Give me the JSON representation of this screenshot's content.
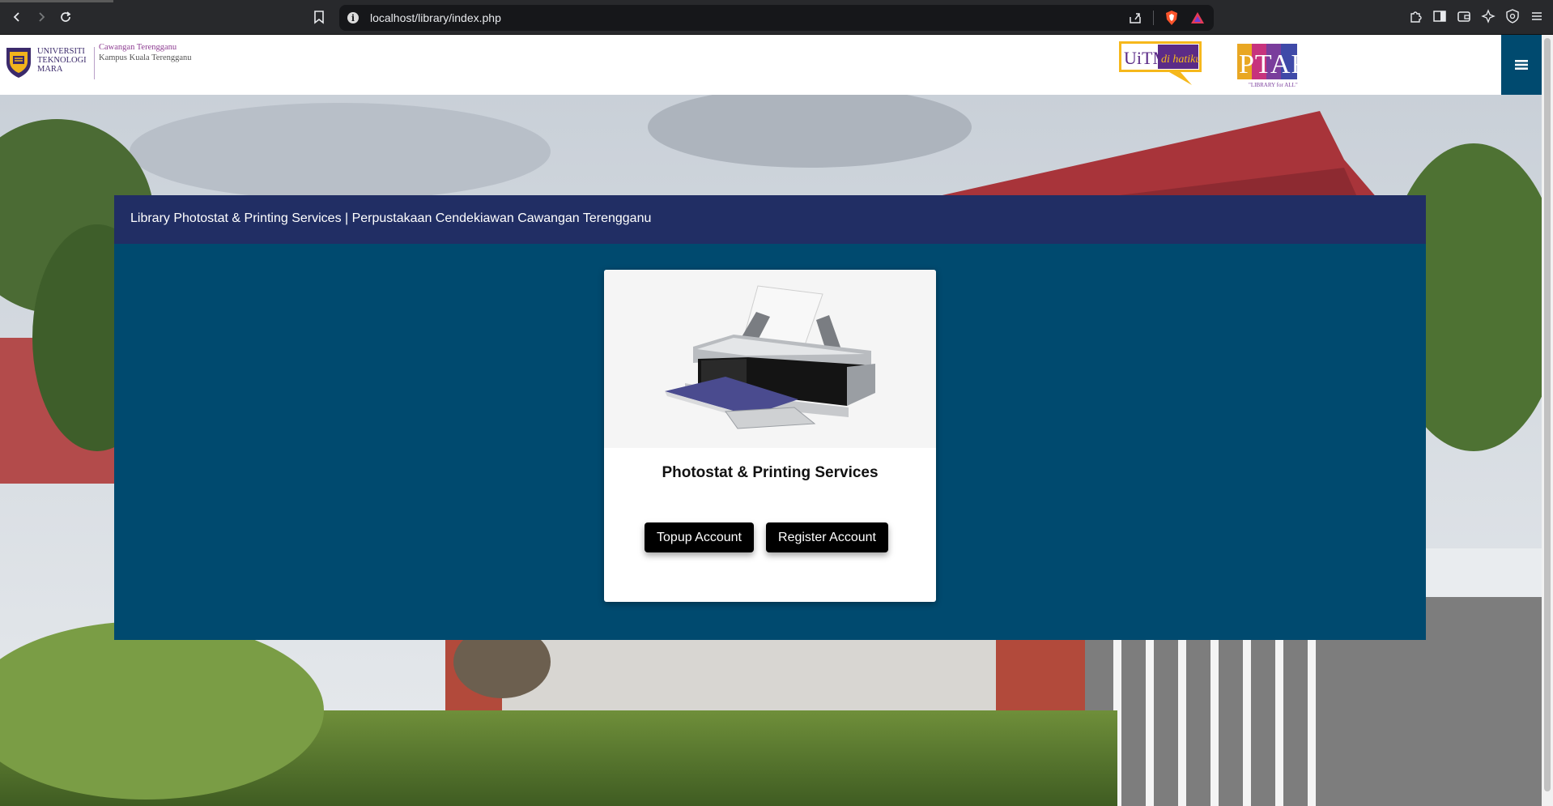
{
  "browser": {
    "url": "localhost/library/index.php",
    "icons": {
      "back": "back-arrow-icon",
      "forward": "forward-arrow-icon",
      "reload": "reload-icon",
      "bookmark": "bookmark-icon",
      "site_info": "info-icon",
      "share": "share-icon",
      "shields": "brave-shield-icon",
      "rewards": "brave-rewards-icon",
      "extensions": "extensions-icon",
      "sidebar": "sidebar-icon",
      "wallet": "wallet-icon",
      "leo": "leo-ai-icon",
      "vpn": "vpn-icon",
      "menu": "menu-icon"
    }
  },
  "header": {
    "uitm_logo": {
      "name_lines": [
        "UNIVERSITI",
        "TEKNOLOGI",
        "MARA"
      ],
      "campus_line1": "Cawangan Terengganu",
      "campus_line2": "Kampus Kuala Terengganu"
    },
    "hatiku_logo": {
      "text1": "UiTM",
      "text2": "di hatiku"
    },
    "ptar_logo": {
      "text": "PTAR",
      "tagline": "\"LIBRARY for ALL\""
    },
    "menu_icon": "hamburger-icon"
  },
  "panel": {
    "title": "Library Photostat & Printing Services | Perpustakaan Cendekiawan Cawangan Terengganu",
    "card": {
      "image": "printer-illustration",
      "title": "Photostat & Printing Services",
      "buttons": {
        "topup": "Topup Account",
        "register": "Register Account"
      }
    }
  },
  "colors": {
    "header_bar": "#212e64",
    "panel_bg": "#004a6f",
    "button_bg": "#000000",
    "menu_button": "#004a6f"
  }
}
